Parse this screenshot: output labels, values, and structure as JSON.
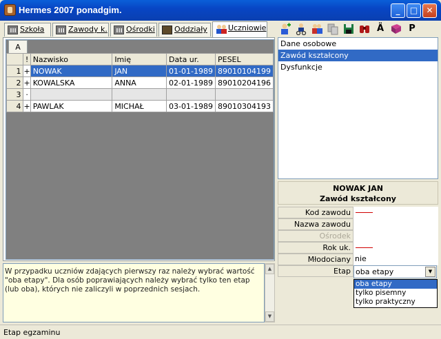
{
  "window": {
    "title": "Hermes 2007 ponadgim."
  },
  "tabs": [
    {
      "label": "Szkoła",
      "icon": "building-icon",
      "active": false
    },
    {
      "label": "Zawody k.",
      "icon": "building-icon",
      "active": false
    },
    {
      "label": "Ośrodki",
      "icon": "building-icon",
      "active": false
    },
    {
      "label": "Oddziały",
      "icon": "classroom-icon",
      "active": false
    },
    {
      "label": "Uczniowie",
      "icon": "students-icon",
      "active": true
    }
  ],
  "toolbar": {
    "glyphs": {
      "replace": "Ä",
      "p": "P"
    },
    "icons": [
      "add-person-icon",
      "cut-person-icon",
      "move-person-icon",
      "copy-icon",
      "save-icon",
      "binoculars-icon",
      "replace-char-icon",
      "book-icon",
      "p-icon"
    ]
  },
  "grid": {
    "sheet_tab": "A",
    "columns": [
      "!",
      "Nazwisko",
      "Imię",
      "Data ur.",
      "PESEL"
    ],
    "rows": [
      {
        "n": "1",
        "mark": "+",
        "nazwisko": "NOWAK",
        "imie": "JAN",
        "data": "01-01-1989",
        "pesel": "89010104199",
        "selected": true
      },
      {
        "n": "2",
        "mark": "+",
        "nazwisko": "KOWALSKA",
        "imie": "ANNA",
        "data": "02-01-1989",
        "pesel": "89010204196",
        "selected": false
      },
      {
        "n": "3",
        "mark": "·",
        "nazwisko": "",
        "imie": "",
        "data": "",
        "pesel": "",
        "selected": false
      },
      {
        "n": "4",
        "mark": "+",
        "nazwisko": "PAWLAK",
        "imie": "MICHAŁ",
        "data": "03-01-1989",
        "pesel": "89010304193",
        "selected": false
      }
    ]
  },
  "hint": "W przypadku uczniów zdających pierwszy raz należy wybrać wartość \"oba etapy\". Dla osób poprawiających należy wybrać tylko ten etap (lub oba), których nie zaliczyli w poprzednich sesjach.",
  "menu": [
    {
      "label": "Dane osobowe",
      "selected": false
    },
    {
      "label": "Zawód kształcony",
      "selected": true
    },
    {
      "label": "Dysfunkcje",
      "selected": false
    }
  ],
  "person": {
    "name": "NOWAK JAN",
    "section": "Zawód kształcony"
  },
  "fields": [
    {
      "label": "Kod zawodu",
      "value": "",
      "required": true,
      "disabled": false
    },
    {
      "label": "Nazwa zawodu",
      "value": "",
      "required": false,
      "disabled": false
    },
    {
      "label": "Ośrodek",
      "value": "",
      "required": false,
      "disabled": true
    },
    {
      "label": "Rok uk.",
      "value": "",
      "required": true,
      "disabled": false
    },
    {
      "label": "Młodociany pracow.",
      "value": "nie",
      "required": false,
      "disabled": false
    },
    {
      "label": "Etap",
      "value": "",
      "required": false,
      "disabled": false
    }
  ],
  "etap": {
    "selected": "oba etapy",
    "options": [
      "oba etapy",
      "tylko pisemny",
      "tylko praktyczny"
    ]
  },
  "status": "Etap egzaminu"
}
